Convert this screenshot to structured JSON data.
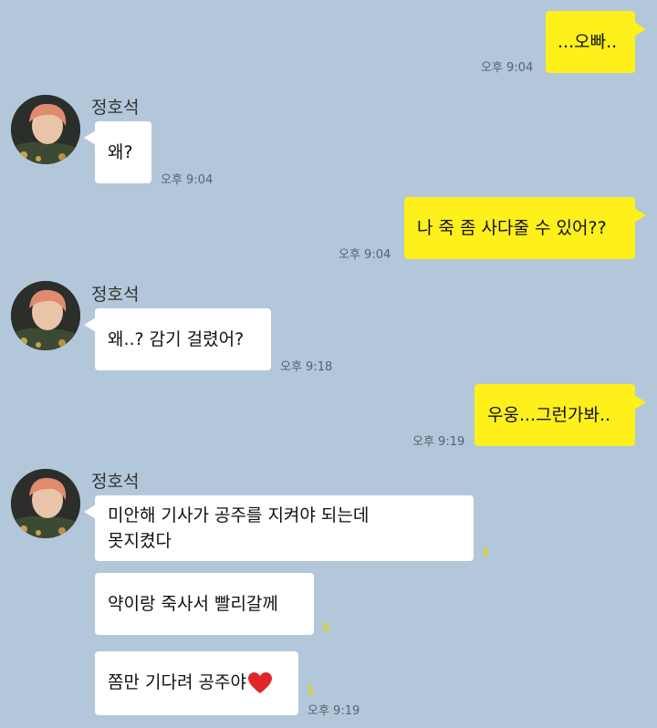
{
  "colors": {
    "background": "#b2c7d9",
    "my_bubble": "#fef01b",
    "their_bubble": "#ffffff",
    "unread": "#e8d400"
  },
  "contact": {
    "name": "정호석"
  },
  "messages": {
    "m1": {
      "text": "...오빠..",
      "time": "오후 9:04"
    },
    "m2": {
      "text": "왜?",
      "time": "오후 9:04"
    },
    "m3": {
      "text": "나 죽 좀 사다줄 수 있어??",
      "time": "오후 9:04"
    },
    "m4": {
      "text": "왜..? 감기 걸렸어?",
      "time": "오후 9:18"
    },
    "m5": {
      "text": "우웅...그런가봐..",
      "time": "오후 9:19"
    },
    "m6": {
      "line1": "미안해 기사가 공주를 지켜야 되는데",
      "line2": "못지켰다",
      "unread": "1"
    },
    "m7": {
      "text": "약이랑 죽사서 빨리갈께",
      "unread": "1"
    },
    "m8": {
      "text": "쫌만 기다려 공주야",
      "icon": "red-heart-icon",
      "unread": "1",
      "time": "오후 9:19"
    }
  }
}
